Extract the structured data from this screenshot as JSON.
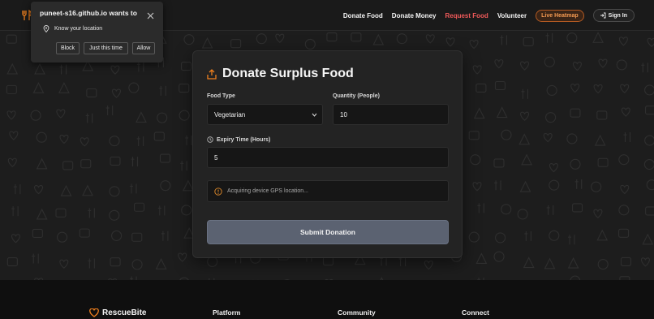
{
  "nav": {
    "links": [
      "Donate Food",
      "Donate Money",
      "Request Food",
      "Volunteer"
    ],
    "active_link": "Request Food",
    "heatmap_label": "Live Heatmap",
    "signin_label": "Sign In"
  },
  "permission": {
    "title": "puneet-s16.github.io wants to",
    "request": "Know your location",
    "buttons": [
      "Block",
      "Just this time",
      "Allow"
    ]
  },
  "form": {
    "title": "Donate Surplus Food",
    "food_type_label": "Food Type",
    "food_type_value": "Vegetarian",
    "quantity_label": "Quantity (People)",
    "quantity_value": "10",
    "expiry_label": "Expiry Time (Hours)",
    "expiry_value": "5",
    "status_text": "Acquiring device GPS location...",
    "submit_label": "Submit Donation"
  },
  "footer": {
    "brand": "RescueBite",
    "columns": [
      "Platform",
      "Community",
      "Connect"
    ]
  },
  "colors": {
    "accent": "#f0801e",
    "active_link": "#f05a5a",
    "submit_bg": "#5b6271"
  },
  "icons": [
    "fork-knife-icon",
    "sign-in-icon",
    "close-icon",
    "location-pin-icon",
    "share-upload-icon",
    "clock-icon",
    "info-icon",
    "heart-icon",
    "chevron-down-icon"
  ]
}
